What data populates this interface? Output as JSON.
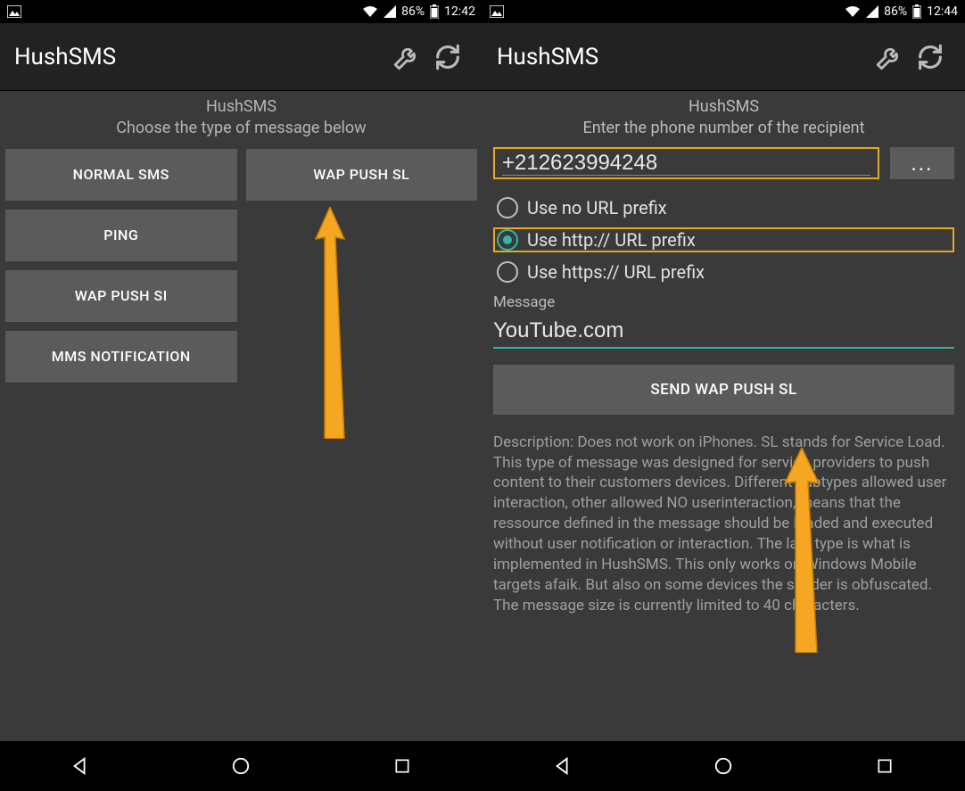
{
  "left": {
    "status": {
      "battery": "86%",
      "time": "12:42"
    },
    "app_title": "HushSMS",
    "heading_line1": "HushSMS",
    "heading_line2": "Choose the type of message below",
    "buttons": {
      "normal_sms": "NORMAL SMS",
      "wap_push_sl": "WAP PUSH SL",
      "ping": "PING",
      "wap_push_si": "WAP PUSH SI",
      "mms_notification": "MMS NOTIFICATION"
    }
  },
  "right": {
    "status": {
      "battery": "86%",
      "time": "12:44"
    },
    "app_title": "HushSMS",
    "heading_line1": "HushSMS",
    "heading_line2": "Enter the phone number of the recipient",
    "phone_value": "+212623994248",
    "more_label": "...",
    "radios": {
      "no_prefix": "Use no URL prefix",
      "http_prefix": "Use http:// URL prefix",
      "https_prefix": "Use https:// URL prefix",
      "selected": "http_prefix"
    },
    "message_label": "Message",
    "message_value": "YouTube.com",
    "send_label": "SEND WAP PUSH SL",
    "description": "Description: Does not work on iPhones. SL stands for Service Load. This type of message was designed for service providers to push content to their customers devices. Different subtypes allowed user interaction, other allowed NO userinteraction, means that the ressource defined in the message should be loaded and executed without user notification or interaction. The last type is what is implemented in HushSMS. This only works on Windows Mobile targets afaik. But also on some devices the sender is obfuscated. The message size is currently limited to 40 characters."
  }
}
